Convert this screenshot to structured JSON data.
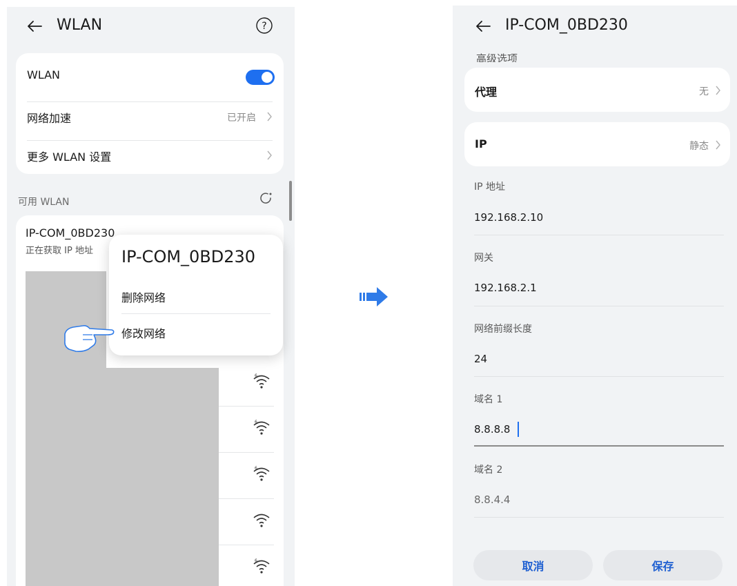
{
  "left": {
    "title": "WLAN",
    "card": {
      "wlan_label": "WLAN",
      "accel_label": "网络加速",
      "accel_value": "已开启",
      "more_label": "更多 WLAN 设置"
    },
    "available_label": "可用 WLAN",
    "network": {
      "ssid": "IP-COM_0BD230",
      "status": "正在获取 IP 地址",
      "status_partial": "正在获取 IP 地址"
    },
    "popup": {
      "title": "IP-COM_0BD230",
      "delete": "删除网络",
      "modify": "修改网络"
    },
    "icons": [
      "back-arrow-icon",
      "help-icon",
      "refresh-icon",
      "wifi-icon",
      "hand-pointer-icon"
    ],
    "toggle_state": "on"
  },
  "arrow_icon": "right-arrow-icon",
  "right": {
    "title": "IP-COM_0BD230",
    "clipped_heading": "高级选项",
    "proxy": {
      "label": "代理",
      "value": "无"
    },
    "ip_mode": {
      "label": "IP",
      "value": "静态"
    },
    "fields": [
      {
        "label": "IP 地址",
        "value": "192.168.2.10"
      },
      {
        "label": "网关",
        "value": "192.168.2.1"
      },
      {
        "label": "网络前缀长度",
        "value": "24"
      },
      {
        "label": "域名 1",
        "value": "8.8.8.8"
      },
      {
        "label": "域名 2",
        "value": "8.8.4.4"
      }
    ],
    "cancel": "取消",
    "save": "保存"
  },
  "colors": {
    "accent": "#1e6ff0",
    "button_text": "#1e5fd1",
    "arrow": "#2f7be8"
  }
}
